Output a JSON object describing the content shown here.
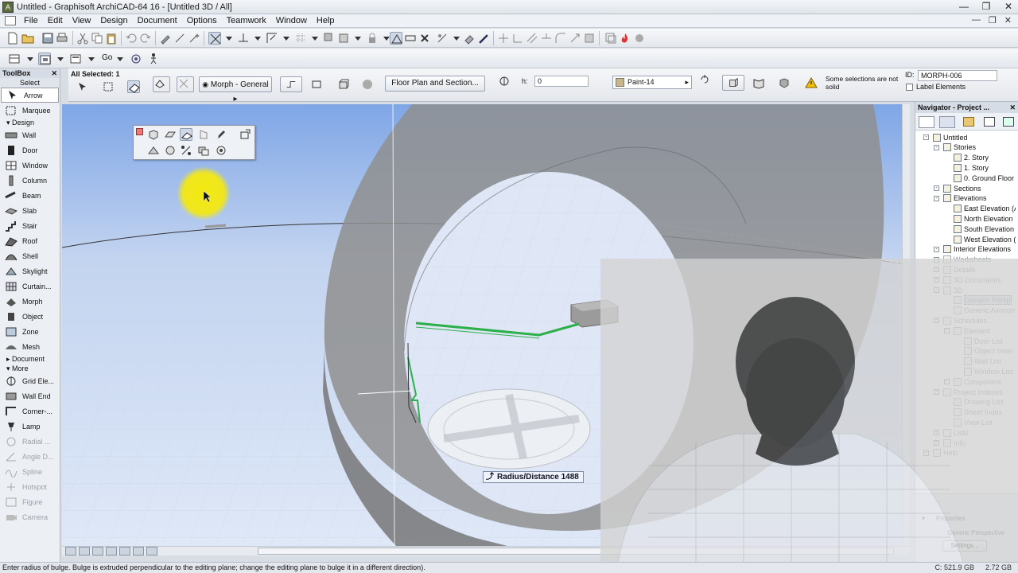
{
  "window": {
    "title": "Untitled - Graphisoft ArchiCAD-64 16 - [Untitled 3D / All]",
    "app_icon": "archicad-icon"
  },
  "menu": [
    "File",
    "Edit",
    "View",
    "Design",
    "Document",
    "Options",
    "Teamwork",
    "Window",
    "Help"
  ],
  "toolbar": {
    "go_label": "Go"
  },
  "infobox": {
    "selection": "All Selected: 1",
    "morph_label": "Morph - General",
    "floor_plan_btn": "Floor Plan and Section...",
    "h_label": "h:",
    "h_value": "0",
    "material": "Paint-14",
    "warning": "Some selections are not solid",
    "id_label": "ID:",
    "id_value": "MORPH-006",
    "label_elements": "Label Elements"
  },
  "toolbox": {
    "title": "ToolBox",
    "select_label": "Select",
    "arrow": "Arrow",
    "marquee": "Marquee",
    "design_section": "Design",
    "design_tools": [
      {
        "label": "Wall",
        "icon": "wall-icon"
      },
      {
        "label": "Door",
        "icon": "door-icon"
      },
      {
        "label": "Window",
        "icon": "window-icon"
      },
      {
        "label": "Column",
        "icon": "column-icon"
      },
      {
        "label": "Beam",
        "icon": "beam-icon"
      },
      {
        "label": "Slab",
        "icon": "slab-icon"
      },
      {
        "label": "Stair",
        "icon": "stair-icon"
      },
      {
        "label": "Roof",
        "icon": "roof-icon"
      },
      {
        "label": "Shell",
        "icon": "shell-icon"
      },
      {
        "label": "Skylight",
        "icon": "skylight-icon"
      },
      {
        "label": "Curtain...",
        "icon": "curtain-wall-icon"
      },
      {
        "label": "Morph",
        "icon": "morph-icon"
      },
      {
        "label": "Object",
        "icon": "object-icon"
      },
      {
        "label": "Zone",
        "icon": "zone-icon"
      },
      {
        "label": "Mesh",
        "icon": "mesh-icon"
      }
    ],
    "document_section": "Document",
    "more_section": "More",
    "more_tools": [
      {
        "label": "Grid Ele...",
        "icon": "grid-icon",
        "disabled": false
      },
      {
        "label": "Wall End",
        "icon": "wall-end-icon",
        "disabled": false
      },
      {
        "label": "Corner-...",
        "icon": "corner-window-icon",
        "disabled": false
      },
      {
        "label": "Lamp",
        "icon": "lamp-icon",
        "disabled": false
      },
      {
        "label": "Radial ...",
        "icon": "radial-dimension-icon",
        "disabled": true
      },
      {
        "label": "Angle D...",
        "icon": "angle-dimension-icon",
        "disabled": true
      },
      {
        "label": "Spline",
        "icon": "spline-icon",
        "disabled": true
      },
      {
        "label": "Hotspot",
        "icon": "hotspot-icon",
        "disabled": true
      },
      {
        "label": "Figure",
        "icon": "figure-icon",
        "disabled": true
      },
      {
        "label": "Camera",
        "icon": "camera-icon",
        "disabled": true
      }
    ]
  },
  "viewport": {
    "tooltip": "Radius/Distance 1488",
    "cursor_highlight_color": "#f3ea10"
  },
  "navigator": {
    "title": "Navigator - Project ...",
    "tree": [
      {
        "label": "Untitled",
        "level": 0,
        "dim": false
      },
      {
        "label": "Stories",
        "level": 1,
        "dim": false
      },
      {
        "label": "2. Story",
        "level": 2,
        "dim": false
      },
      {
        "label": "1. Story",
        "level": 2,
        "dim": false
      },
      {
        "label": "0. Ground Floor",
        "level": 2,
        "dim": false
      },
      {
        "label": "Sections",
        "level": 1,
        "dim": false
      },
      {
        "label": "Elevations",
        "level": 1,
        "dim": false
      },
      {
        "label": "East Elevation (A",
        "level": 2,
        "dim": false
      },
      {
        "label": "North Elevation",
        "level": 2,
        "dim": false
      },
      {
        "label": "South Elevation",
        "level": 2,
        "dim": false
      },
      {
        "label": "West Elevation (",
        "level": 2,
        "dim": false
      },
      {
        "label": "Interior Elevations",
        "level": 1,
        "dim": false
      },
      {
        "label": "Worksheets",
        "level": 1,
        "dim": true
      },
      {
        "label": "Details",
        "level": 1,
        "dim": true
      },
      {
        "label": "3D Documents",
        "level": 1,
        "dim": true
      },
      {
        "label": "3D",
        "level": 1,
        "dim": true
      },
      {
        "label": "Generic Persp",
        "level": 2,
        "dim": true,
        "selected": true
      },
      {
        "label": "Generic Axonom",
        "level": 2,
        "dim": true
      },
      {
        "label": "Schedules",
        "level": 1,
        "dim": true
      },
      {
        "label": "Element",
        "level": 2,
        "dim": true
      },
      {
        "label": "Door List",
        "level": 3,
        "dim": true
      },
      {
        "label": "Object Inver",
        "level": 3,
        "dim": true
      },
      {
        "label": "Wall List",
        "level": 3,
        "dim": true
      },
      {
        "label": "Window List",
        "level": 3,
        "dim": true
      },
      {
        "label": "Component",
        "level": 2,
        "dim": true
      },
      {
        "label": "Project Indexes",
        "level": 1,
        "dim": true
      },
      {
        "label": "Drawing List",
        "level": 2,
        "dim": true
      },
      {
        "label": "Sheet Index",
        "level": 2,
        "dim": true
      },
      {
        "label": "View List",
        "level": 2,
        "dim": true
      },
      {
        "label": "Lists",
        "level": 1,
        "dim": true
      },
      {
        "label": "Info",
        "level": 1,
        "dim": true
      },
      {
        "label": "Help",
        "level": 0,
        "dim": true
      }
    ],
    "properties_label": "Properties",
    "properties_value": "Generic Perspective",
    "settings_btn": "Settings..."
  },
  "status": {
    "message": "Enter radius of bulge. Bulge is extruded perpendicular to the editing plane; change the editing plane to bulge it in a different direction).",
    "disk": "C: 521.9 GB",
    "memory": "2.72 GB"
  },
  "colors": {
    "selection_green": "#2bb04a",
    "sky_top": "#7fa6e6",
    "sky_bottom": "#dfe8f7",
    "torus": "#8f8f8f"
  }
}
